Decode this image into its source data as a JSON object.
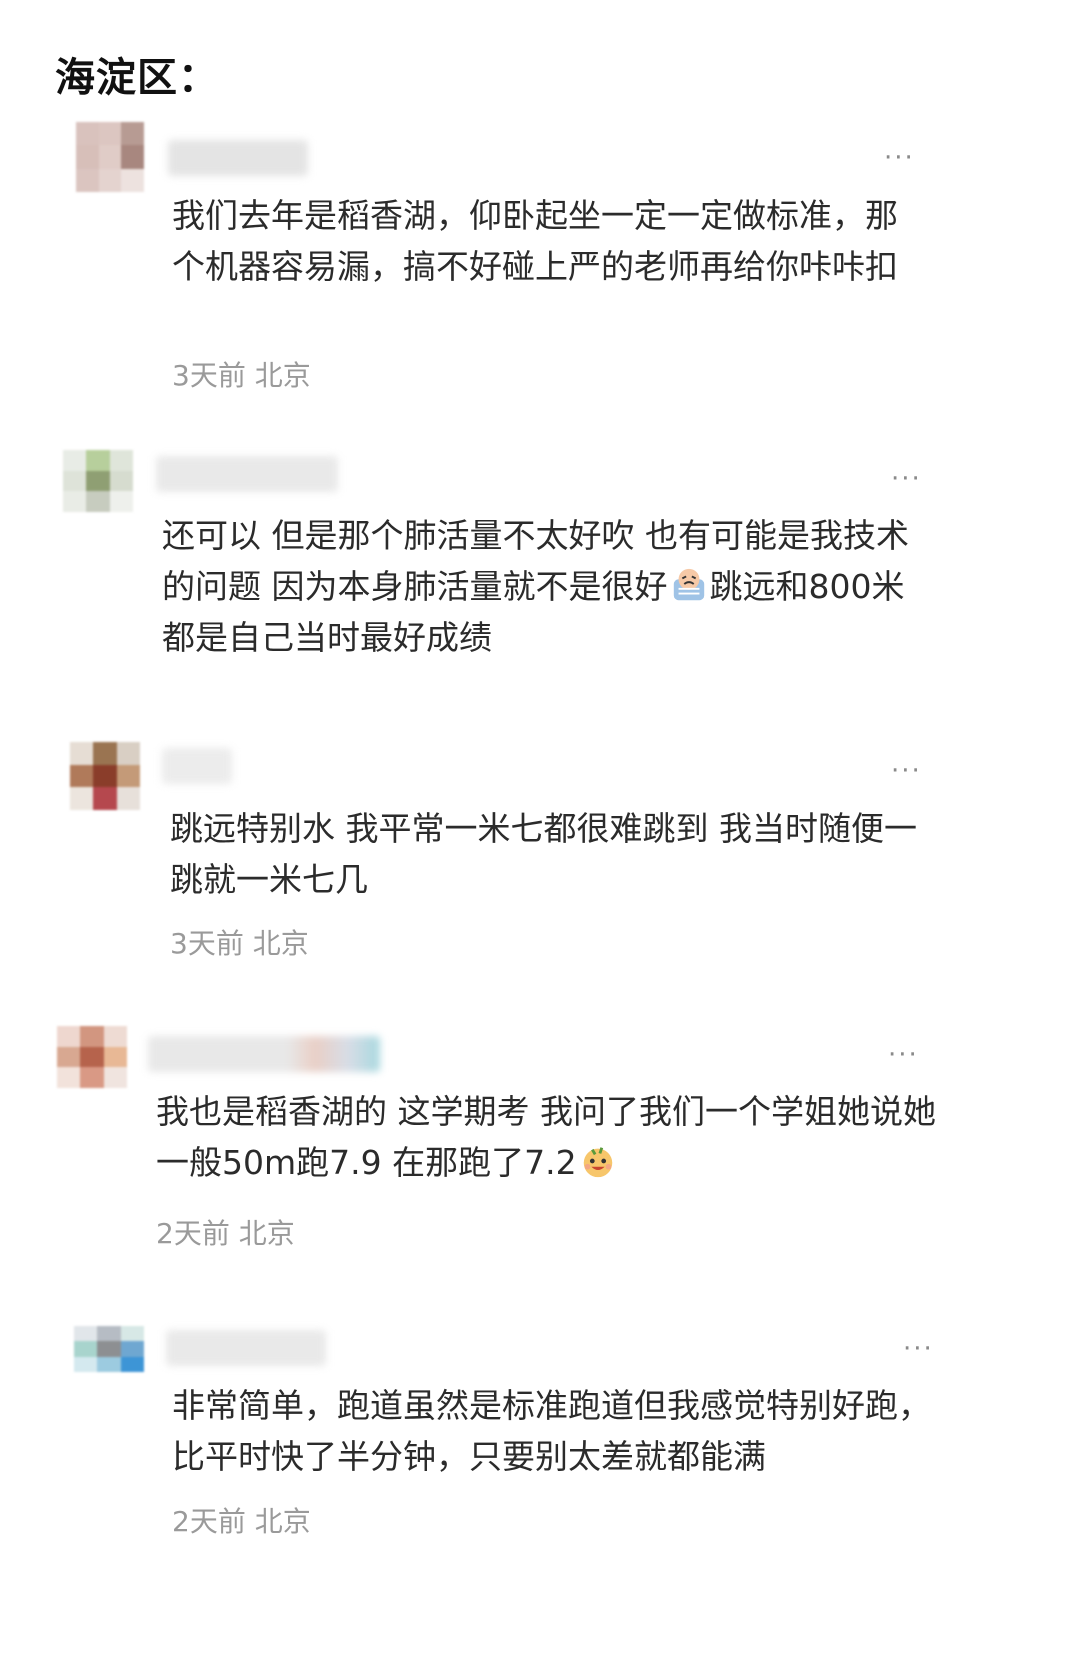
{
  "page_title": "海淀区：",
  "colors": {
    "text": "#2b2b2b",
    "meta": "#9a9a9a",
    "icon": "#8a8a8a"
  },
  "comments": [
    {
      "username": "",
      "text": "我们去年是稻香湖，仰卧起坐一定一定做标准，那个机器容易漏，搞不好碰上严的老师再给你咔咔扣",
      "meta": "3天前 北京",
      "more_icon": "more-dots-icon"
    },
    {
      "username": "",
      "text_before_emoji": "还可以 但是那个肺活量不太好吹 也有可能是我技术的问题 因为本身肺活量就不是很好",
      "emoji": "crying-emoji-icon",
      "text_after_emoji": "跳远和800米都是自己当时最好成绩",
      "meta": "",
      "more_icon": "more-dots-icon"
    },
    {
      "username": "",
      "text": "跳远特别水 我平常一米七都很难跳到 我当时随便一跳就一米七几",
      "meta": "3天前 北京",
      "more_icon": "more-dots-icon"
    },
    {
      "username": "",
      "text_before_emoji": "我也是稻香湖的 这学期考 我问了我们一个学姐她说她一般50m跑7.9 在那跑了7.2",
      "emoji": "grinning-face-emoji-icon",
      "meta": "2天前 北京",
      "more_icon": "more-dots-icon"
    },
    {
      "username": "",
      "text": "非常简单，跑道虽然是标准跑道但我感觉特别好跑，比平时快了半分钟，只要别太差就都能满",
      "meta": "2天前 北京",
      "more_icon": "more-dots-icon"
    }
  ]
}
